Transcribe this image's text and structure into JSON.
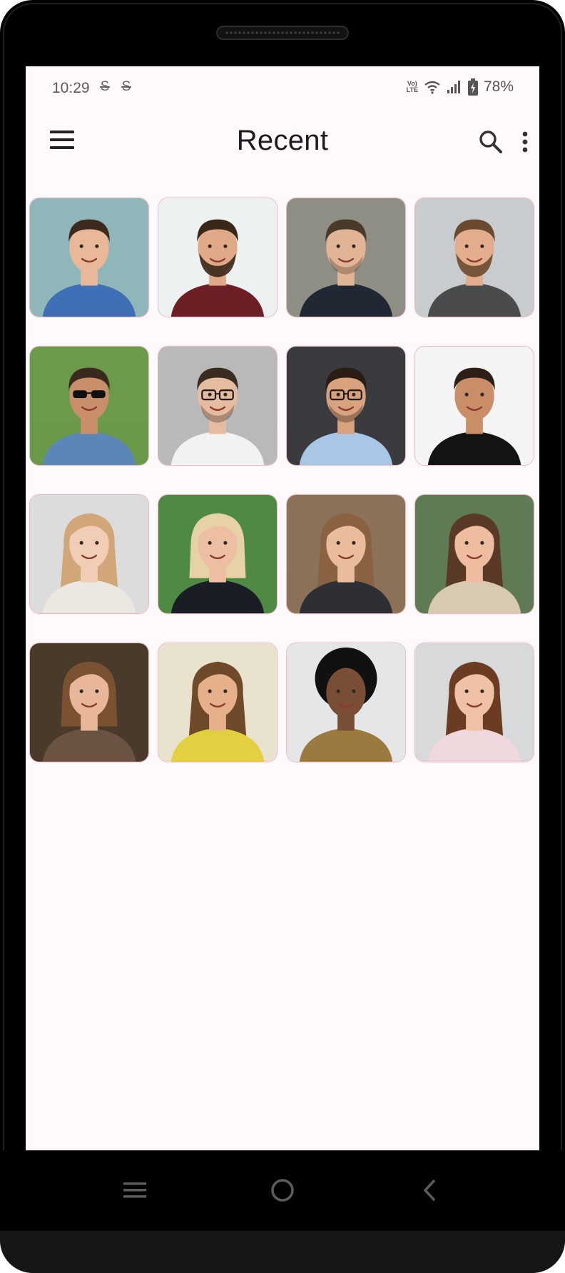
{
  "status_bar": {
    "time": "10:29",
    "notification_icons": [
      "s-notification-icon",
      "s-notification-icon"
    ],
    "network_label": "VoLTE",
    "battery_percent": "78%"
  },
  "app_bar": {
    "title": "Recent",
    "menu_icon": "hamburger-menu-icon",
    "search_icon": "search-icon",
    "more_icon": "more-vert-icon"
  },
  "photos": [
    {
      "bg": "#8fb6b8",
      "skin": "#e8b898",
      "hair": "#3c2a1e",
      "shirt": "#3f6fb5",
      "beard": "none",
      "glasses": "none",
      "hair_style": "short"
    },
    {
      "bg": "#eef1f2",
      "skin": "#e0aa88",
      "hair": "#3a271a",
      "shirt": "#6e1f26",
      "beard": "yes",
      "glasses": "none",
      "hair_style": "short"
    },
    {
      "bg": "#8f8e84",
      "skin": "#e2b496",
      "hair": "#4a3a2c",
      "shirt": "#1f2833",
      "beard": "stubble",
      "glasses": "none",
      "hair_style": "short"
    },
    {
      "bg": "#c9ccce",
      "skin": "#e4ae8e",
      "hair": "#6b4a30",
      "shirt": "#4b4b4b",
      "beard": "yes",
      "glasses": "none",
      "hair_style": "short"
    },
    {
      "bg": "#6a9a4a",
      "skin": "#c98f6a",
      "hair": "#3a2a1e",
      "shirt": "#5b86b8",
      "beard": "none",
      "glasses": "sunglasses",
      "hair_style": "short"
    },
    {
      "bg": "#b9b9b9",
      "skin": "#e6bca0",
      "hair": "#3b2c22",
      "shirt": "#f2f2f2",
      "beard": "stubble",
      "glasses": "yes",
      "hair_style": "short"
    },
    {
      "bg": "#3a3b3f",
      "skin": "#d9a27e",
      "hair": "#2a1d14",
      "shirt": "#a9c6e6",
      "beard": "stubble",
      "glasses": "yes",
      "hair_style": "short"
    },
    {
      "bg": "#f4f4f4",
      "skin": "#c98e68",
      "hair": "#2d1f16",
      "shirt": "#141414",
      "beard": "none",
      "glasses": "none",
      "hair_style": "short"
    },
    {
      "bg": "#dcdcdc",
      "skin": "#f0cdb4",
      "hair": "#d1a77a",
      "shirt": "#ebe8e2",
      "beard": "none",
      "glasses": "none",
      "hair_style": "long"
    },
    {
      "bg": "#4f8a44",
      "skin": "#edbfa2",
      "hair": "#e6d2a6",
      "shirt": "#1b1d26",
      "beard": "none",
      "glasses": "none",
      "hair_style": "bob"
    },
    {
      "bg": "#8b7258",
      "skin": "#e9bc9c",
      "hair": "#8a6242",
      "shirt": "#2e2e35",
      "beard": "none",
      "glasses": "none",
      "hair_style": "long"
    },
    {
      "bg": "#5f7a55",
      "skin": "#eebd9f",
      "hair": "#5a3a26",
      "shirt": "#d8c9b2",
      "beard": "none",
      "glasses": "none",
      "hair_style": "long"
    },
    {
      "bg": "#4a3a2c",
      "skin": "#e8b698",
      "hair": "#7a5232",
      "shirt": "#6b5343",
      "beard": "none",
      "glasses": "none",
      "hair_style": "bob"
    },
    {
      "bg": "#e9e2cf",
      "skin": "#e6b08a",
      "hair": "#6f4a2a",
      "shirt": "#e3d040",
      "beard": "none",
      "glasses": "none",
      "hair_style": "long"
    },
    {
      "bg": "#e4e6e8",
      "skin": "#7a4e34",
      "hair": "#111111",
      "shirt": "#9a7a3e",
      "beard": "none",
      "glasses": "none",
      "hair_style": "afro"
    },
    {
      "bg": "#d7d9db",
      "skin": "#efc2a6",
      "hair": "#6b3c22",
      "shirt": "#efd9dd",
      "beard": "none",
      "glasses": "none",
      "hair_style": "long"
    }
  ],
  "nav_bar": {
    "recents_icon": "recent-apps-icon",
    "home_icon": "home-icon",
    "back_icon": "back-icon"
  }
}
